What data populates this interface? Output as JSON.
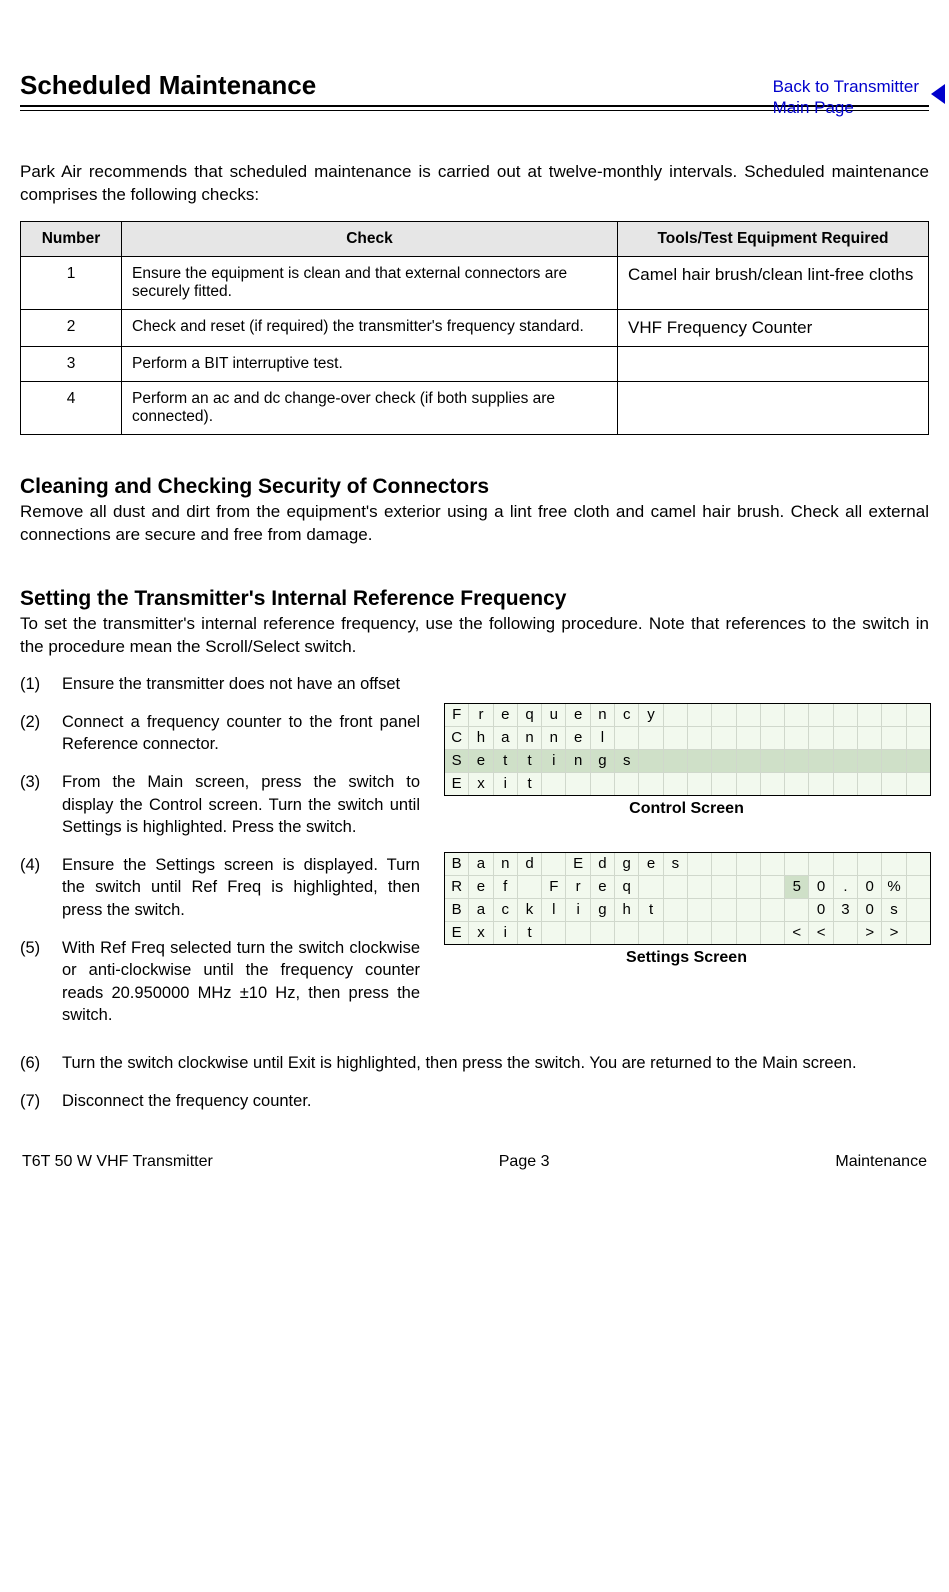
{
  "header": {
    "backlink_line1": "Back to Transmitter",
    "backlink_line2": "Main Page"
  },
  "title": "Scheduled Maintenance",
  "intro": "Park Air recommends that scheduled maintenance is carried out at twelve-monthly intervals. Scheduled maintenance comprises the following checks:",
  "table": {
    "headers": {
      "num": "Number",
      "check": "Check",
      "tools": "Tools/Test Equipment Required"
    },
    "rows": [
      {
        "num": "1",
        "check": "Ensure the equipment is clean and that external connectors are securely fitted.",
        "tools": "Camel hair brush/clean lint-free cloths"
      },
      {
        "num": "2",
        "check": "Check and reset (if required) the transmitter's frequency standard.",
        "tools": "VHF Frequency Counter"
      },
      {
        "num": "3",
        "check": "Perform a BIT interruptive test.",
        "tools": ""
      },
      {
        "num": "4",
        "check": "Perform an ac and dc change-over check (if both supplies are connected).",
        "tools": ""
      }
    ]
  },
  "section_clean": {
    "heading": "Cleaning and Checking Security of Connectors",
    "body": "Remove all dust and dirt from the equipment's exterior using a lint free cloth and camel hair brush. Check all external connections are secure and free from damage."
  },
  "section_freq": {
    "heading": "Setting the Transmitter's Internal Reference Frequency",
    "body": "To set the transmitter's internal reference frequency, use the following procedure. Note that references to the switch in the procedure mean the Scroll/Select switch."
  },
  "steps_left": [
    {
      "n": "(1)",
      "t": "Ensure the transmitter does not have an offset"
    },
    {
      "n": "(2)",
      "t": "Connect a frequency counter to the front panel Reference connector."
    },
    {
      "n": "(3)",
      "t": "From the Main screen, press the switch to display the Control screen. Turn the switch until Settings is highlighted. Press the switch."
    },
    {
      "n": "(4)",
      "t": "Ensure the Settings screen is displayed. Turn the switch until Ref Freq is highlighted, then press the switch."
    },
    {
      "n": "(5)",
      "t": "With Ref Freq selected turn the switch clockwise or anti-clockwise until the frequency counter reads 20.950000 MHz ±10 Hz, then press the switch."
    }
  ],
  "steps_full": [
    {
      "n": "(6)",
      "t": "Turn the switch clockwise until Exit is highlighted, then press the switch. You are returned to the Main screen."
    },
    {
      "n": "(7)",
      "t": "Disconnect the frequency counter."
    }
  ],
  "control_screen": {
    "label": "Control Screen",
    "rows": [
      [
        "F",
        "r",
        "e",
        "q",
        "u",
        "e",
        "n",
        "c",
        "y",
        "",
        "",
        "",
        "",
        "",
        "",
        "",
        "",
        "",
        "",
        ""
      ],
      [
        "C",
        "h",
        "a",
        "n",
        "n",
        "e",
        "l",
        "",
        "",
        "",
        "",
        "",
        "",
        "",
        "",
        "",
        "",
        "",
        "",
        ""
      ],
      [
        "S",
        "e",
        "t",
        "t",
        "i",
        "n",
        "g",
        "s",
        "",
        "",
        "",
        "",
        "",
        "",
        "",
        "",
        "",
        "",
        "",
        ""
      ],
      [
        "E",
        "x",
        "i",
        "t",
        "",
        "",
        "",
        "",
        "",
        "",
        "",
        "",
        "",
        "",
        "",
        "",
        "",
        "",
        "",
        ""
      ]
    ],
    "highlight": {
      "row": 2
    }
  },
  "settings_screen": {
    "label": "Settings Screen",
    "rows": [
      [
        "B",
        "a",
        "n",
        "d",
        "",
        "E",
        "d",
        "g",
        "e",
        "s",
        "",
        "",
        "",
        "",
        "",
        "",
        "",
        "",
        "",
        ""
      ],
      [
        "R",
        "e",
        "f",
        "",
        "F",
        "r",
        "e",
        "q",
        "",
        "",
        "",
        "",
        "",
        "",
        "5",
        "0",
        ".",
        "0",
        "%",
        ""
      ],
      [
        "B",
        "a",
        "c",
        "k",
        "l",
        "i",
        "g",
        "h",
        "t",
        "",
        "",
        "",
        "",
        "",
        "",
        "0",
        "3",
        "0",
        "s",
        ""
      ],
      [
        "E",
        "x",
        "i",
        "t",
        "",
        "",
        "",
        "",
        "",
        "",
        "",
        "",
        "",
        "",
        "<",
        "<",
        "",
        ">",
        ">",
        ""
      ]
    ],
    "highlight_cell": {
      "row": 1,
      "col": 14
    }
  },
  "footer": {
    "left": "T6T 50 W VHF Transmitter",
    "center": "Page 3",
    "right": "Maintenance"
  }
}
